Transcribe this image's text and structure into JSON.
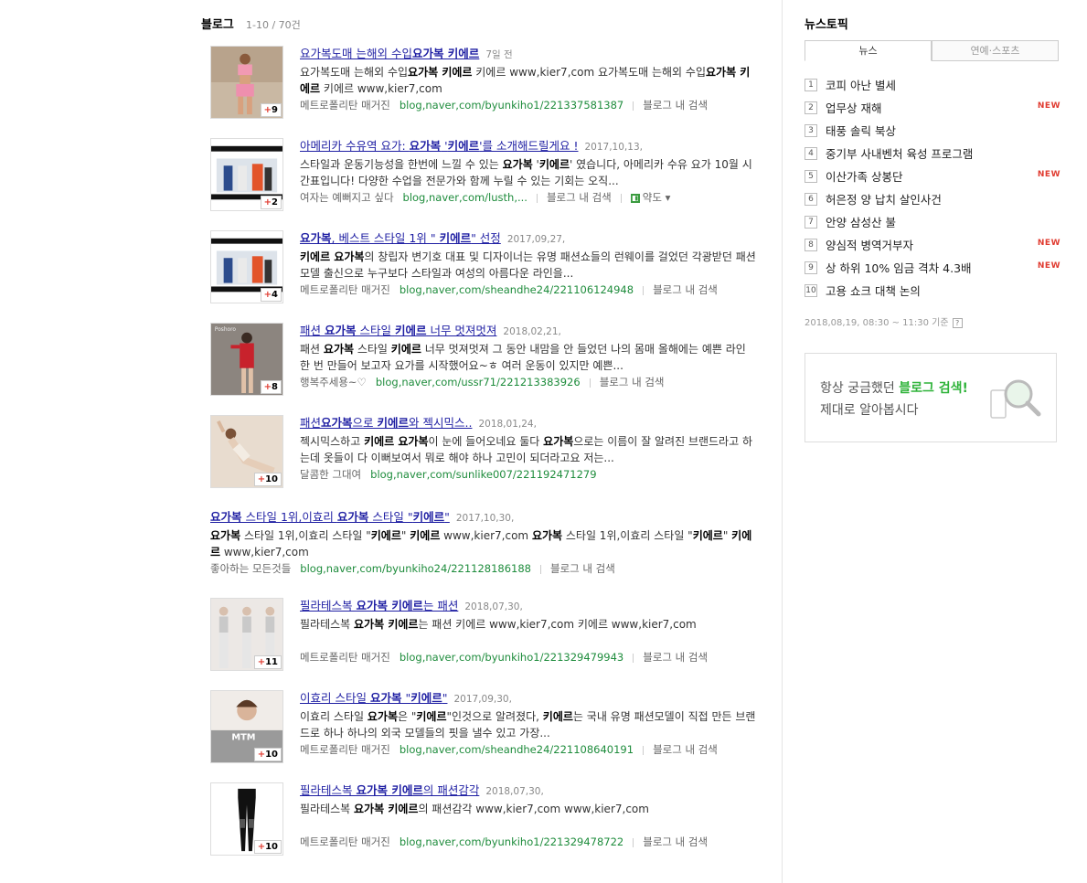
{
  "section": {
    "title": "블로그",
    "count": "1-10 / 70건"
  },
  "results": [
    {
      "title_html": "요가복도매 는해외 수입<b>요가복 키에르</b>",
      "date": "7일 전",
      "desc_html": "요가복도매 는해외 수입<b>요가복 키에르</b> 키에르 www,kier7,com 요가복도매 는해외 수입<b>요가복 키에르</b> 키에르 www,kier7,com",
      "blog": "메트로폴리탄 매거진",
      "url": "blog,naver,com/byunkiho1/221337581387",
      "search_in_blog": "블로그 내 검색",
      "count": "9",
      "thumb": "pink-outfit"
    },
    {
      "title_html": "아메리카 수유역 요가: <b>요가복</b> '<b>키에르</b>'를 소개해드릴게요 !",
      "date": "2017,10,13,",
      "desc_html": "스타일과 운동기능성을 한번에 느낄 수 있는 <b>요가복</b> '<b>키에르</b>' 였습니다, 아메리카 수유 요가 10월 시간표입니다! 다양한 수업을 전문가와 함께 누릴 수 있는 기회는 오직...",
      "blog": "여자는 예뻐지고 싶다",
      "url": "blog,naver,com/lusth,...",
      "search_in_blog": "블로그 내 검색",
      "extra": "약도",
      "count": "2",
      "thumb": "runway"
    },
    {
      "title_html": "<b>요가복</b>, 베스트 스타일 1위 \" <b>키에르</b>\" 선정",
      "date": "2017,09,27,",
      "desc_html": "<b>키에르 요가복</b>의 창립자 변기호 대표 및 디자이너는 유명 패션쇼들의 런웨이를 걸었던 각광받던 패션모델 출신으로 누구보다 스타일과 여성의 아름다운 라인을...",
      "blog": "메트로폴리탄 매거진",
      "url": "blog,naver,com/sheandhe24/221106124948",
      "search_in_blog": "블로그 내 검색",
      "count": "4",
      "thumb": "runway"
    },
    {
      "title_html": "패션 <b>요가복</b> 스타일 <b>키에르</b> 너무 멋져멋져",
      "date": "2018,02,21,",
      "desc_html": "패션 <b>요가복</b> 스타일 <b>키에르</b> 너무 멋져멋져 그 동안 내맘을 안 들었던 나의 몸매 올해에는 예쁜 라인 한 번 만들어 보고자 요가를 시작했어요~ㅎ 여러 운동이 있지만 예쁜...",
      "blog": "행복주세용~♡",
      "url": "blog,naver,com/ussr71/221213383926",
      "search_in_blog": "블로그 내 검색",
      "count": "8",
      "thumb": "red-outfit"
    },
    {
      "title_html": "패션<b>요가복</b>으로 <b>키에르</b>와 젝시믹스..",
      "date": "2018,01,24,",
      "desc_html": "젝시믹스하고 <b>키에르 요가복</b>이 눈에 들어오네요 둘다 <b>요가복</b>으로는 이름이 잘 알려진 브랜드라고 하는데 옷들이 다 이뻐보여서 뭐로 해야 하나 고민이 되더라고요 저는...",
      "blog": "달콤한 그대여",
      "url": "blog,naver,com/sunlike007/221192471279",
      "search_in_blog": "",
      "count": "10",
      "thumb": "yoga-pose"
    },
    {
      "title_html": "<b>요가복</b> 스타일 1위,이효리 <b>요가복</b> 스타일 \"<b>키에르</b>\"",
      "date": "2017,10,30,",
      "desc_html": "<b>요가복</b> 스타일 1위,이효리 스타일 \"<b>키에르</b>\" <b>키에르</b> www,kier7,com <b>요가복</b> 스타일 1위,이효리 스타일 \"<b>키에르</b>\" <b>키에르</b> www,kier7,com",
      "blog": "좋아하는 모든것들",
      "url": "blog,naver,com/byunkiho24/221128186188",
      "search_in_blog": "블로그 내 검색",
      "count": "",
      "thumb": ""
    },
    {
      "title_html": "필라테스복 <b>요가복 키에르</b>는 패션",
      "date": "2018,07,30,",
      "desc_html": "필라테스복 <b>요가복 키에르</b>는 패션 키에르 www,kier7,com 키에르 www,kier7,com",
      "blog": "메트로폴리탄 매거진",
      "url": "blog,naver,com/byunkiho1/221329479943",
      "search_in_blog": "블로그 내 검색",
      "count": "11",
      "thumb": "three-women"
    },
    {
      "title_html": "이효리 스타일 <b>요가복</b> \"<b>키에르</b>\"",
      "date": "2017,09,30,",
      "desc_html": "이효리 스타일 <b>요가복</b>은 \"<b>키에르</b>\"인것으로 알려졌다, <b>키에르</b>는 국내 유명 패션모델이 직접 만든 브랜드로 하나 하나의 외국 모델들의 핏을 낼수 있고 가장...",
      "blog": "메트로폴리탄 매거진",
      "url": "blog,naver,com/sheandhe24/221108640191",
      "search_in_blog": "블로그 내 검색",
      "count": "10",
      "thumb": "mtm"
    },
    {
      "title_html": "필라테스복 <b>요가복 키에르</b>의 패션감각",
      "date": "2018,07,30,",
      "desc_html": "필라테스복 <b>요가복 키에르</b>의 패션감각 www,kier7,com www,kier7,com",
      "blog": "메트로폴리탄 매거진",
      "url": "blog,naver,com/byunkiho1/221329478722",
      "search_in_blog": "블로그 내 검색",
      "count": "10",
      "thumb": "leggings"
    }
  ],
  "sidebar": {
    "title": "뉴스토픽",
    "tabs": [
      "뉴스",
      "연예·스포츠"
    ],
    "news": [
      {
        "rank": "1",
        "text": "코피 아난 별세",
        "new": ""
      },
      {
        "rank": "2",
        "text": "업무상 재해",
        "new": "NEW"
      },
      {
        "rank": "3",
        "text": "태풍 솔릭 북상",
        "new": ""
      },
      {
        "rank": "4",
        "text": "중기부 사내벤처 육성 프로그램",
        "new": ""
      },
      {
        "rank": "5",
        "text": "이산가족 상봉단",
        "new": "NEW"
      },
      {
        "rank": "6",
        "text": "허은정 양 납치 살인사건",
        "new": ""
      },
      {
        "rank": "7",
        "text": "안양 삼성산 불",
        "new": ""
      },
      {
        "rank": "8",
        "text": "양심적 병역거부자",
        "new": "NEW"
      },
      {
        "rank": "9",
        "text": "상 하위 10% 임금 격차 4.3배",
        "new": "NEW"
      },
      {
        "rank": "10",
        "text": "고용 쇼크 대책 논의",
        "new": ""
      }
    ],
    "timestamp": "2018,08,19, 08:30 ~ 11:30 기준",
    "help": "?",
    "promo": {
      "line1_a": "항상 궁금했던 ",
      "line1_hl": "블로그 검색!",
      "line2": "제대로 알아봅시다"
    }
  },
  "colors": {
    "link": "#1f1fa3",
    "url": "#1e8c3c",
    "new": "#e03c31",
    "promo_hl": "#2fb33a"
  }
}
